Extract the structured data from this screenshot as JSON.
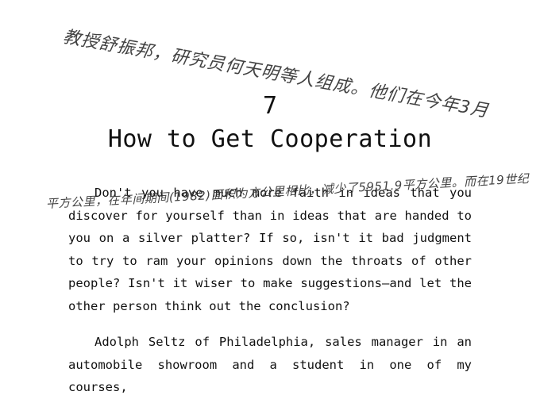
{
  "annotations": {
    "top": "教授舒振邦，研究员何天明等人组成。他们在今年3月",
    "middle": "平方公里，在年间期间(1982)面积为方公里相比，减少了5951.9平方公里。而在19世纪"
  },
  "chapter": {
    "number": "7",
    "title": "How to Get Cooperation"
  },
  "paragraphs": [
    "Don't you have much more faith in ideas that you discover for yourself than in ideas that are handed to you on a silver platter? If so, isn't it bad judgment to try to ram your opinions down the throats of other people? Isn't it wiser to make suggestions—and let the other person think out the conclusion?",
    "Adolph Seltz of Philadelphia, sales manager in an automobile showroom and a student in one of my courses,"
  ]
}
